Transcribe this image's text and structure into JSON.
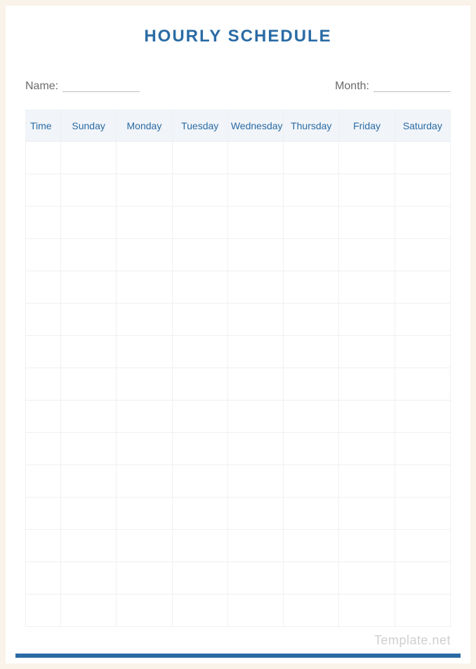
{
  "title": "HOURLY SCHEDULE",
  "fields": {
    "name_label": "Name:",
    "name_value": "",
    "month_label": "Month:",
    "month_value": ""
  },
  "table": {
    "headers": [
      "Time",
      "Sunday",
      "Monday",
      "Tuesday",
      "Wednesday",
      "Thursday",
      "Friday",
      "Saturday"
    ],
    "row_count": 15
  },
  "watermark": "Template.net"
}
